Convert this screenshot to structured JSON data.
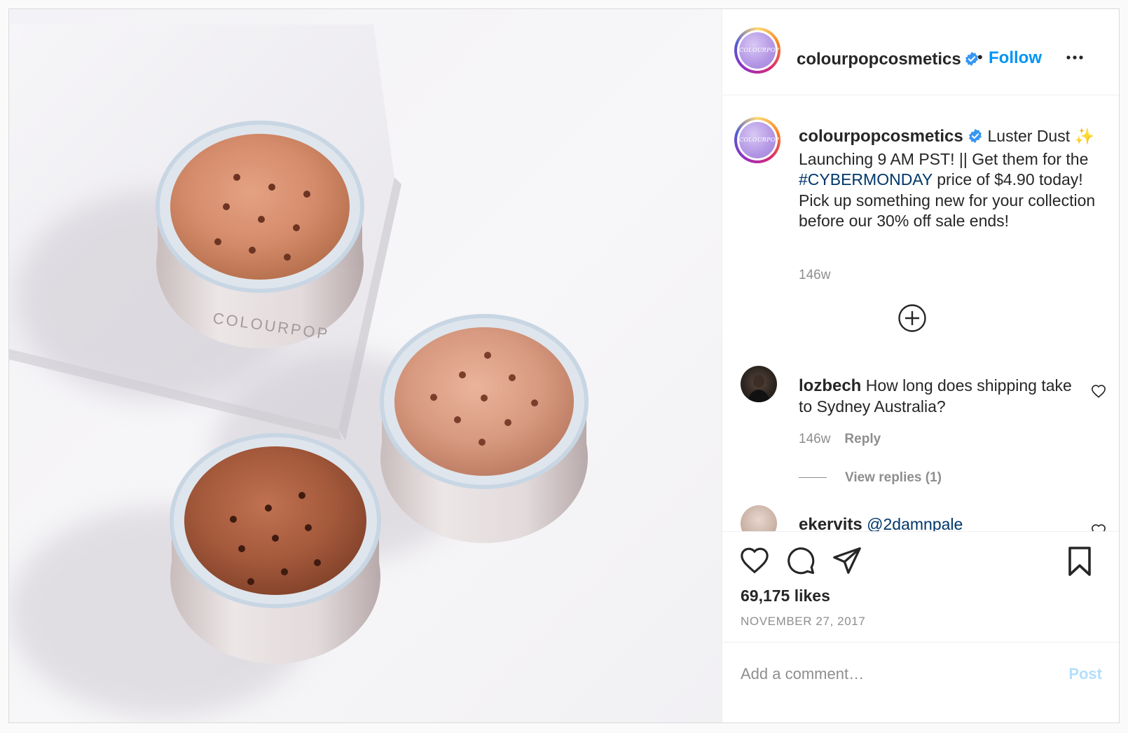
{
  "post": {
    "image_alt": "Three jars of Colourpop Luster Dust loose glitter powder on a white surface",
    "jar_brand_text": "COLOURPOP"
  },
  "header": {
    "avatar_text": "COLOURPOP",
    "username": "colourpopcosmetics",
    "separator": "•",
    "follow_label": "Follow",
    "more_icon": "ellipsis-icon"
  },
  "caption": {
    "username": "colourpopcosmetics",
    "text_before": "Luster Dust ✨ Launching 9 AM PST! || Get them for the ",
    "hashtag": "#CYBERMONDAY",
    "text_after": " price of $4.90 today! Pick up something new for your collection before our 30% off sale ends!",
    "time": "146w"
  },
  "comments": [
    {
      "username": "lozbech",
      "text": "How long does shipping take to Sydney Australia?",
      "time": "146w",
      "reply_label": "Reply",
      "view_replies": "View replies (1)"
    },
    {
      "username": "ekervits",
      "mention": "@2damnpale"
    }
  ],
  "actions": {
    "like_icon": "heart-icon",
    "comment_icon": "comment-icon",
    "share_icon": "share-icon",
    "save_icon": "bookmark-icon",
    "likes": "69,175 likes",
    "date": "NOVEMBER 27, 2017"
  },
  "add_comment": {
    "placeholder": "Add a comment…",
    "post_label": "Post"
  },
  "colors": {
    "link_blue": "#0095f6",
    "hashtag_blue": "#00376b",
    "muted": "#8e8e8e",
    "post_disabled": "#b2dffc",
    "verified": "#3897f0"
  }
}
